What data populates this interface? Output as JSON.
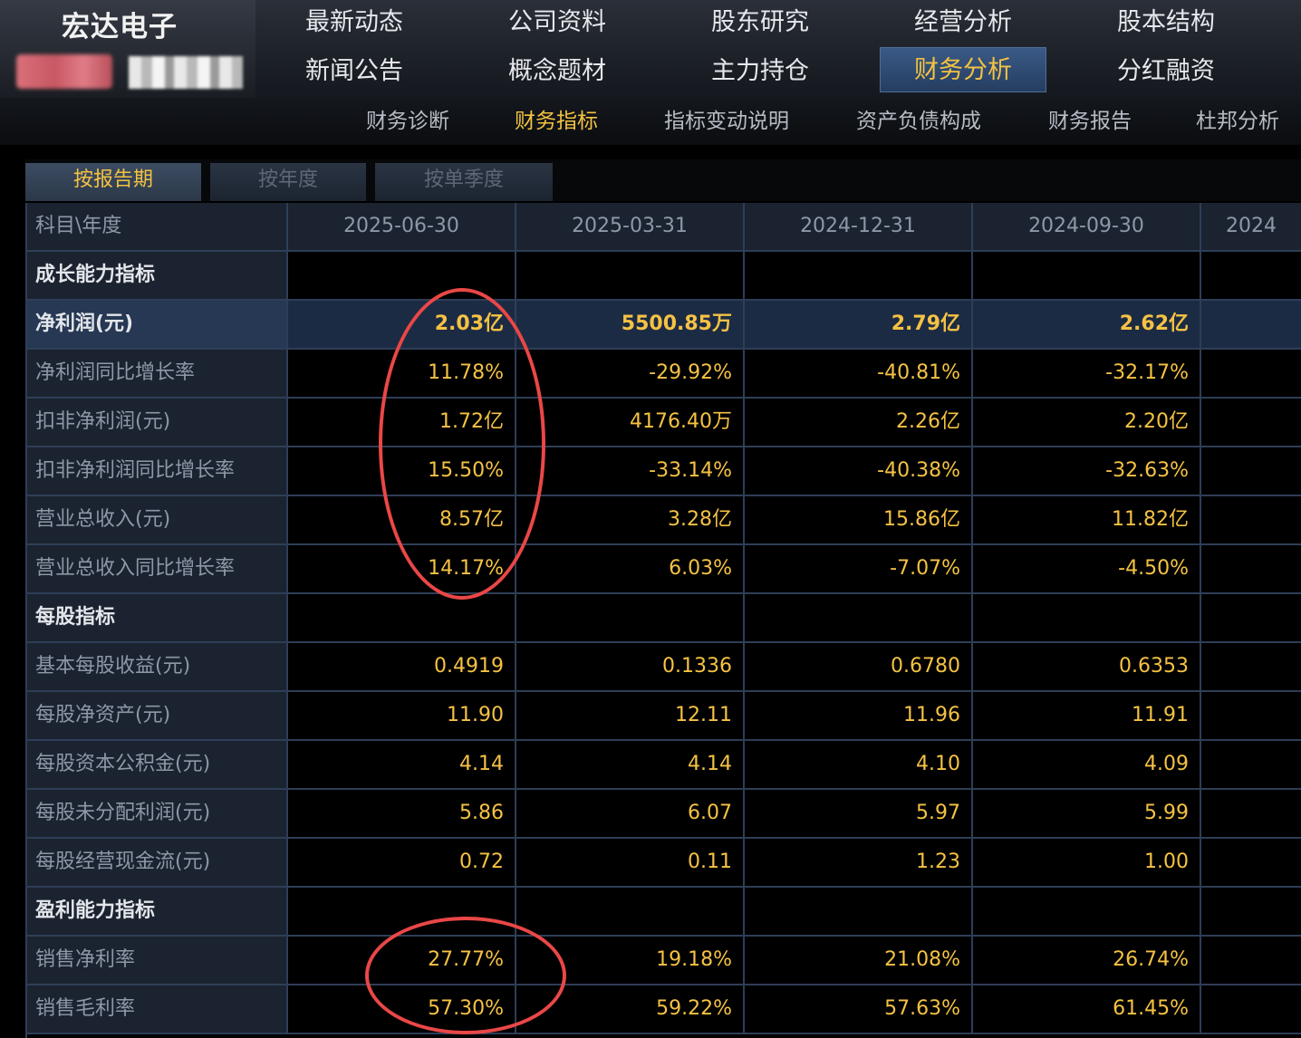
{
  "header": {
    "stock_name": "宏达电子",
    "nav_row1": [
      "最新动态",
      "公司资料",
      "股东研究",
      "经营分析",
      "股本结构"
    ],
    "nav_row2": [
      "新闻公告",
      "概念题材",
      "主力持仓",
      "财务分析",
      "分红融资"
    ],
    "active_nav": "财务分析"
  },
  "subnav": {
    "items": [
      "财务诊断",
      "财务指标",
      "指标变动说明",
      "资产负债构成",
      "财务报告",
      "杜邦分析"
    ],
    "active": "财务指标"
  },
  "tabs": {
    "items": [
      "按报告期",
      "按年度",
      "按单季度"
    ],
    "active": "按报告期"
  },
  "table": {
    "corner": "科目\\年度",
    "columns": [
      "2025-06-30",
      "2025-03-31",
      "2024-12-31",
      "2024-09-30",
      "2024"
    ],
    "rows": [
      {
        "label": "成长能力指标",
        "type": "section",
        "values": [
          "",
          "",
          "",
          "",
          ""
        ]
      },
      {
        "label": "净利润(元)",
        "type": "highlight",
        "values": [
          "2.03亿",
          "5500.85万",
          "2.79亿",
          "2.62亿",
          ""
        ]
      },
      {
        "label": "净利润同比增长率",
        "type": "data",
        "values": [
          "11.78%",
          "-29.92%",
          "-40.81%",
          "-32.17%",
          ""
        ]
      },
      {
        "label": "扣非净利润(元)",
        "type": "data",
        "values": [
          "1.72亿",
          "4176.40万",
          "2.26亿",
          "2.20亿",
          ""
        ]
      },
      {
        "label": "扣非净利润同比增长率",
        "type": "data",
        "values": [
          "15.50%",
          "-33.14%",
          "-40.38%",
          "-32.63%",
          ""
        ]
      },
      {
        "label": "营业总收入(元)",
        "type": "data",
        "values": [
          "8.57亿",
          "3.28亿",
          "15.86亿",
          "11.82亿",
          ""
        ]
      },
      {
        "label": "营业总收入同比增长率",
        "type": "data",
        "values": [
          "14.17%",
          "6.03%",
          "-7.07%",
          "-4.50%",
          ""
        ]
      },
      {
        "label": "每股指标",
        "type": "section",
        "values": [
          "",
          "",
          "",
          "",
          ""
        ]
      },
      {
        "label": "基本每股收益(元)",
        "type": "data",
        "values": [
          "0.4919",
          "0.1336",
          "0.6780",
          "0.6353",
          ""
        ]
      },
      {
        "label": "每股净资产(元)",
        "type": "data",
        "values": [
          "11.90",
          "12.11",
          "11.96",
          "11.91",
          ""
        ]
      },
      {
        "label": "每股资本公积金(元)",
        "type": "data",
        "values": [
          "4.14",
          "4.14",
          "4.10",
          "4.09",
          ""
        ]
      },
      {
        "label": "每股未分配利润(元)",
        "type": "data",
        "values": [
          "5.86",
          "6.07",
          "5.97",
          "5.99",
          ""
        ]
      },
      {
        "label": "每股经营现金流(元)",
        "type": "data",
        "values": [
          "0.72",
          "0.11",
          "1.23",
          "1.00",
          ""
        ]
      },
      {
        "label": "盈利能力指标",
        "type": "section",
        "values": [
          "",
          "",
          "",
          "",
          ""
        ]
      },
      {
        "label": "销售净利率",
        "type": "data",
        "values": [
          "27.77%",
          "19.18%",
          "21.08%",
          "26.74%",
          ""
        ]
      },
      {
        "label": "销售毛利率",
        "type": "data",
        "values": [
          "57.30%",
          "59.22%",
          "57.63%",
          "61.45%",
          ""
        ]
      }
    ]
  },
  "colors": {
    "accent": "#f3c242",
    "annotation": "#ea4747",
    "grid": "#2e3e57"
  }
}
